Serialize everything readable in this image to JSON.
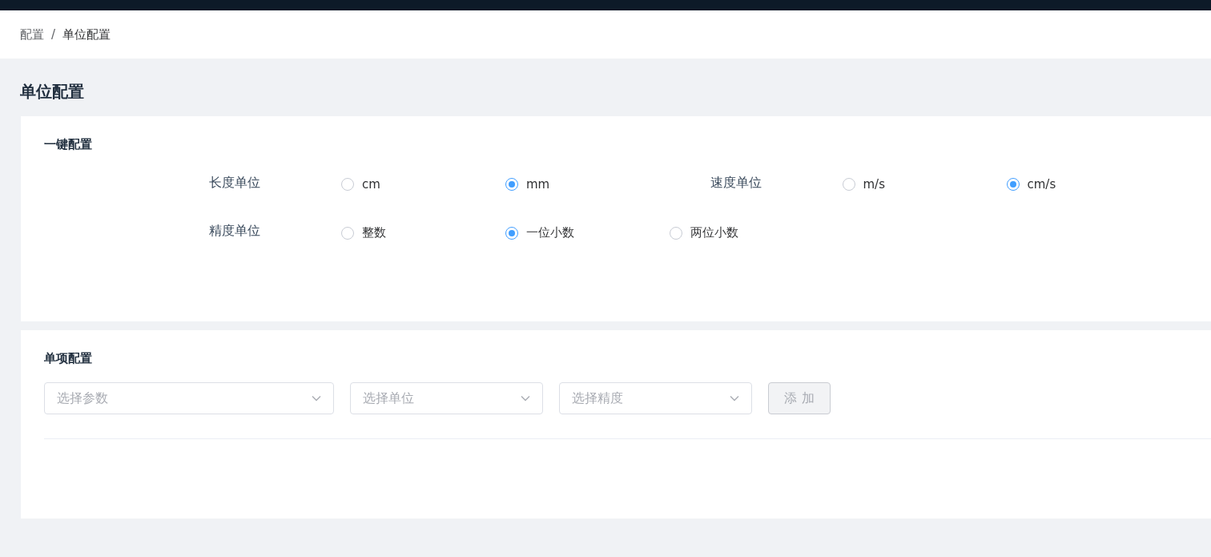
{
  "breadcrumb": [
    {
      "label": "配置",
      "current": false
    },
    {
      "label": "/",
      "current": false
    },
    {
      "label": "单位配置",
      "current": true
    }
  ],
  "page_title": "单位配置",
  "one_click_config": {
    "title": "一键配置",
    "rows": [
      [
        {
          "label": "长度单位",
          "options": [
            {
              "label": "cm",
              "selected": false
            },
            {
              "label": "mm",
              "selected": true
            }
          ]
        },
        {
          "label": "速度单位",
          "options": [
            {
              "label": "m/s",
              "selected": false
            },
            {
              "label": "cm/s",
              "selected": true
            }
          ]
        }
      ],
      [
        {
          "label": "精度单位",
          "options": [
            {
              "label": "整数",
              "selected": false
            },
            {
              "label": "一位小数",
              "selected": true
            },
            {
              "label": "两位小数",
              "selected": false
            }
          ]
        }
      ]
    ]
  },
  "single_config": {
    "title": "单项配置",
    "selects": [
      {
        "placeholder": "选择参数"
      },
      {
        "placeholder": "选择单位"
      },
      {
        "placeholder": "选择精度"
      }
    ],
    "add_button": {
      "label": "添 加",
      "disabled": true
    }
  }
}
